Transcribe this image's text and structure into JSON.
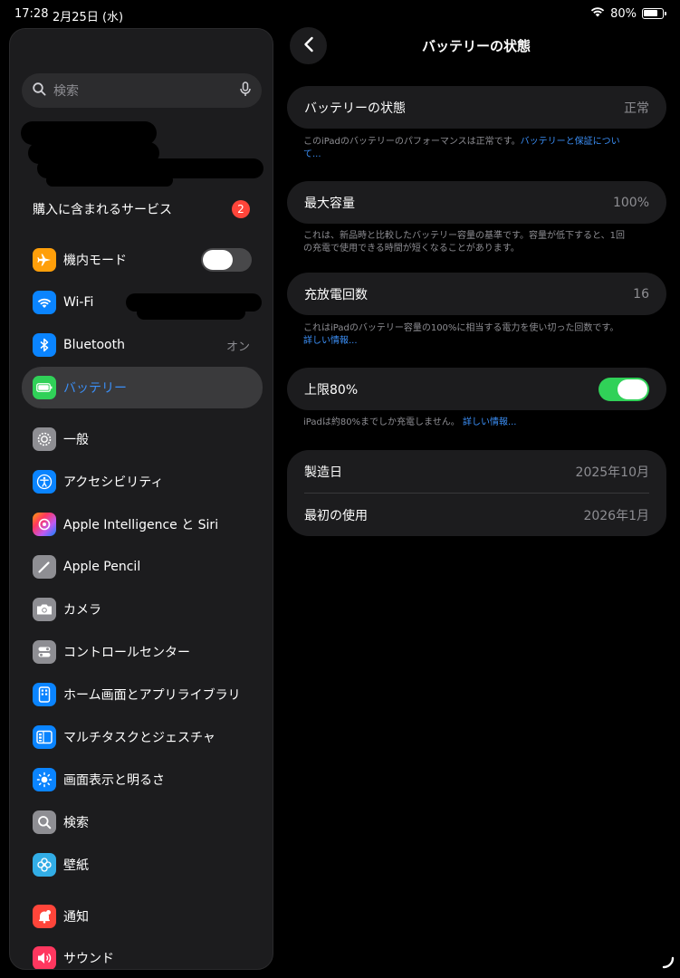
{
  "status": {
    "time": "17:28",
    "date": "2月25日 (水)",
    "battery_pct": "80%"
  },
  "sidebar": {
    "search_placeholder": "検索",
    "purchases": {
      "label": "購入に含まれるサービス",
      "badge": "2"
    },
    "items": [
      {
        "key": "airplane",
        "label": "機内モード",
        "icon": "airplane-icon",
        "color": "#ff9f0a",
        "toggle": false
      },
      {
        "key": "wifi",
        "label": "Wi-Fi",
        "icon": "wifi-icon",
        "color": "#0a84ff"
      },
      {
        "key": "bluetooth",
        "label": "Bluetooth",
        "icon": "bluetooth-icon",
        "color": "#0a84ff",
        "value": "オン"
      },
      {
        "key": "battery",
        "label": "バッテリー",
        "icon": "battery-icon",
        "color": "#30d158",
        "selected": true
      },
      {
        "key": "general",
        "label": "一般",
        "icon": "gear-icon",
        "color": "#8e8e93"
      },
      {
        "key": "accessibility",
        "label": "アクセシビリティ",
        "icon": "accessibility-icon",
        "color": "#0a84ff"
      },
      {
        "key": "ai-siri",
        "label": "Apple Intelligence と Siri",
        "icon": "apple-intelligence-icon",
        "color": "#bf5af2"
      },
      {
        "key": "pencil",
        "label": "Apple Pencil",
        "icon": "pencil-icon",
        "color": "#8e8e93"
      },
      {
        "key": "camera",
        "label": "カメラ",
        "icon": "camera-icon",
        "color": "#8e8e93"
      },
      {
        "key": "control-center",
        "label": "コントロールセンター",
        "icon": "control-center-icon",
        "color": "#8e8e93"
      },
      {
        "key": "home-screen",
        "label": "ホーム画面とアプリライブラリ",
        "icon": "home-screen-icon",
        "color": "#0a84ff"
      },
      {
        "key": "multitasking",
        "label": "マルチタスクとジェスチャ",
        "icon": "multitasking-icon",
        "color": "#0a84ff"
      },
      {
        "key": "display",
        "label": "画面表示と明るさ",
        "icon": "brightness-icon",
        "color": "#0a84ff"
      },
      {
        "key": "search",
        "label": "検索",
        "icon": "search-icon",
        "color": "#8e8e93"
      },
      {
        "key": "wallpaper",
        "label": "壁紙",
        "icon": "wallpaper-icon",
        "color": "#32ade6"
      },
      {
        "key": "notifications",
        "label": "通知",
        "icon": "notifications-icon",
        "color": "#ff453a"
      },
      {
        "key": "sounds",
        "label": "サウンド",
        "icon": "sound-icon",
        "color": "#ff375f"
      }
    ]
  },
  "detail": {
    "title": "バッテリーの状態",
    "health": {
      "label": "バッテリーの状態",
      "value": "正常"
    },
    "health_note": "このiPadのバッテリーのパフォーマンスは正常です。",
    "health_note_link": "バッテリーと保証について...",
    "capacity": {
      "label": "最大容量",
      "value": "100%"
    },
    "capacity_note": "これは、新品時と比較したバッテリー容量の基準です。容量が低下すると、1回の充電で使用できる時間が短くなることがあります。",
    "cycles": {
      "label": "充放電回数",
      "value": "16"
    },
    "cycles_note": "これはiPadのバッテリー容量の100%に相当する電力を使い切った回数です。",
    "cycles_note_link": "詳しい情報...",
    "limit": {
      "label": "上限80%",
      "on": true
    },
    "limit_note": "iPadは約80%までしか充電しません。",
    "limit_note_link": "詳しい情報...",
    "manufactured": {
      "label": "製造日",
      "value": "2025年10月"
    },
    "first_use": {
      "label": "最初の使用",
      "value": "2026年1月"
    }
  }
}
